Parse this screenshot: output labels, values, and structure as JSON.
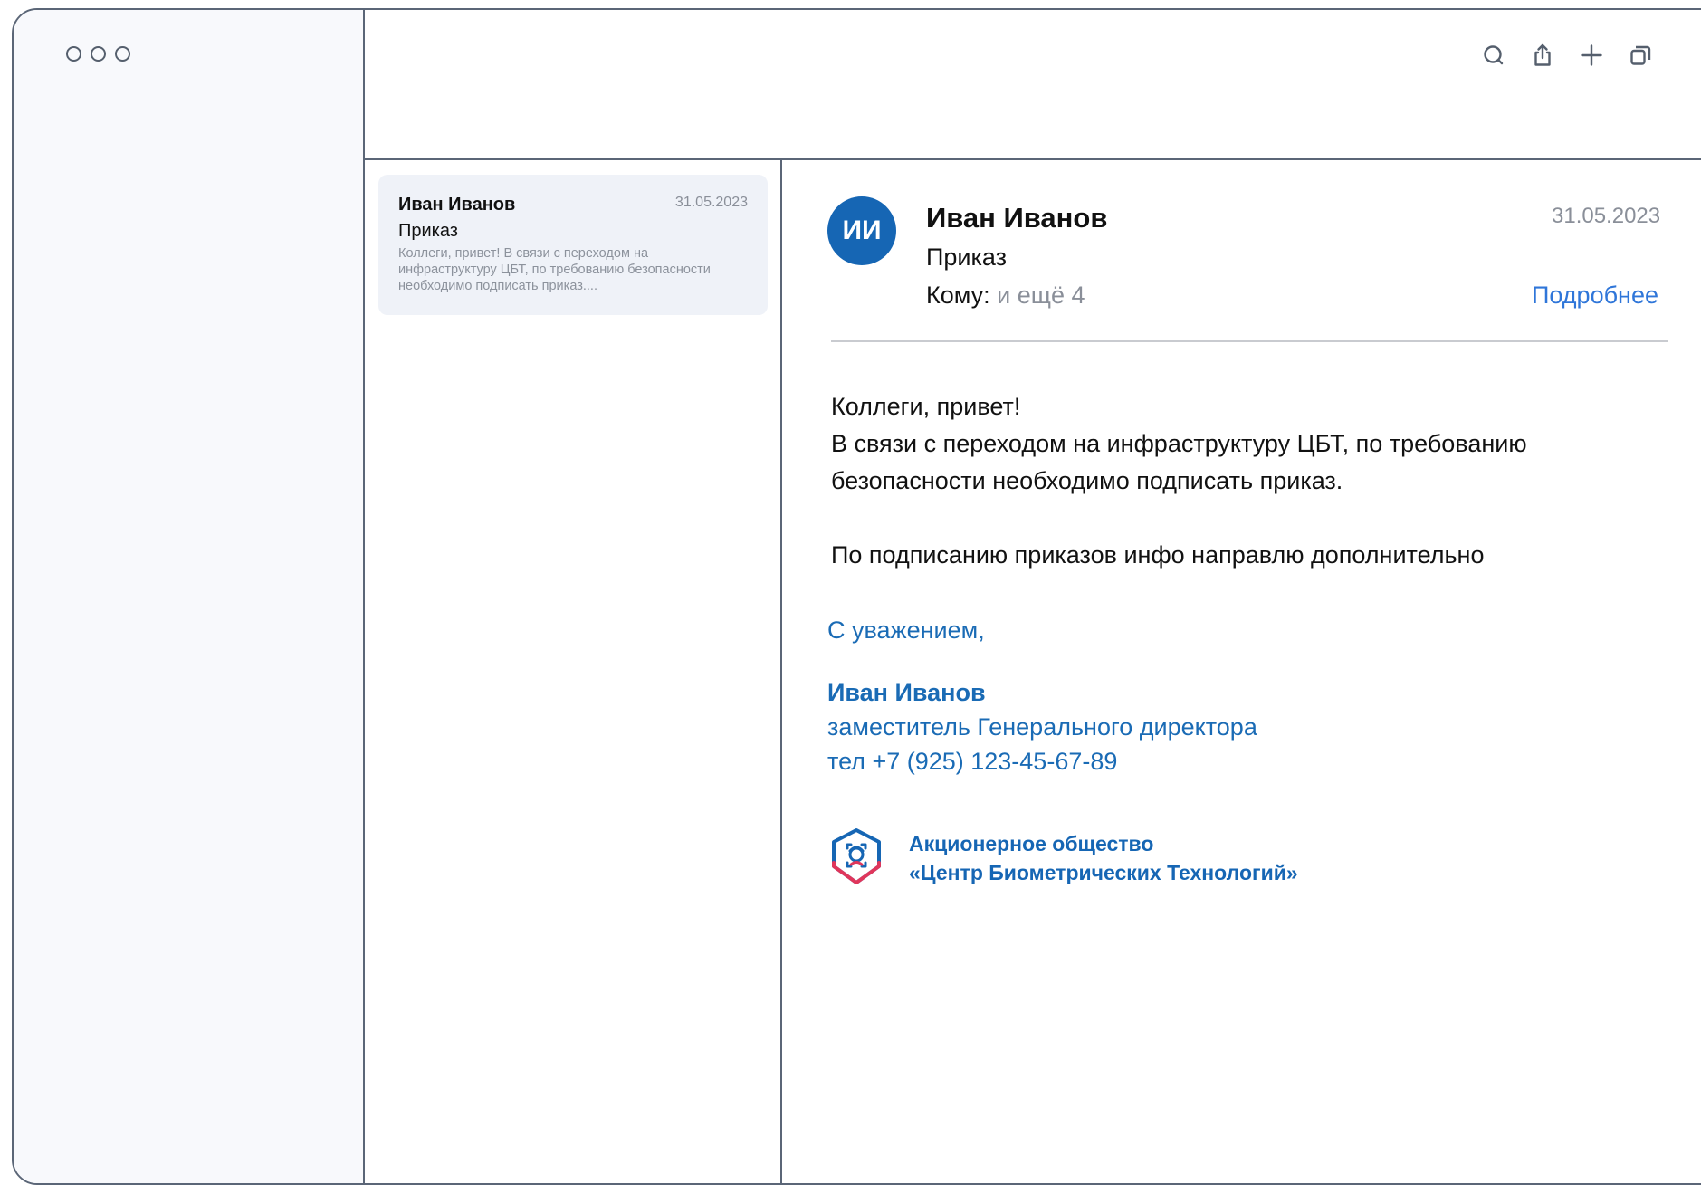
{
  "window": {
    "traffic_lights": [
      "close",
      "minimize",
      "zoom"
    ]
  },
  "toolbar": {
    "icons": [
      "search-icon",
      "share-icon",
      "plus-icon",
      "windows-icon"
    ]
  },
  "message_list": {
    "items": [
      {
        "from": "Иван Иванов",
        "date": "31.05.2023",
        "subject": "Приказ",
        "preview": "Коллеги, привет! В связи с переходом на инфраструктуру ЦБТ, по требованию безопасности необходимо подписать приказ...."
      }
    ]
  },
  "reader": {
    "avatar_initials": "ИИ",
    "from": "Иван Иванов",
    "date": "31.05.2023",
    "subject": "Приказ",
    "to_label": "Кому:",
    "to_extra": "и ещё 4",
    "more_link": "Подробнее",
    "body": {
      "line1": "Коллеги, привет!",
      "line2": "В связи с переходом на инфраструктуру ЦБТ, по требованию",
      "line3": "безопасности необходимо подписать приказ.",
      "line4": "По подписанию приказов инфо направлю дополнительно"
    },
    "signature": {
      "greeting": "С уважением,",
      "name": "Иван Иванов",
      "role": "заместитель Генерального директора",
      "phone": "тел +7 (925) 123-45-67-89",
      "company_line1": "Акционерное общество",
      "company_line2": "«Центр Биометрических Технологий»"
    }
  },
  "colors": {
    "accent": "#1666b4",
    "link": "#2f76d9",
    "muted": "#8a8f99",
    "frame": "#5b6677",
    "card": "#eff2f8"
  }
}
